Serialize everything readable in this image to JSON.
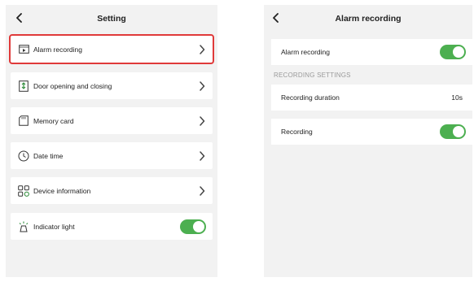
{
  "left_screen": {
    "title": "Setting",
    "items": [
      {
        "label": "Alarm recording",
        "icon": "video-file-icon"
      },
      {
        "label": "Door opening and closing",
        "icon": "door-icon"
      },
      {
        "label": "Memory card",
        "icon": "sd-card-icon"
      },
      {
        "label": "Date time",
        "icon": "clock-icon"
      },
      {
        "label": "Device information",
        "icon": "grid-icon"
      },
      {
        "label": "Indicator light",
        "icon": "light-icon",
        "toggle_on": true
      }
    ]
  },
  "right_screen": {
    "title": "Alarm recording",
    "alarm_recording_label": "Alarm recording",
    "alarm_recording_on": true,
    "section_label": "RECORDING SETTINGS",
    "duration_label": "Recording duration",
    "duration_value": "10s",
    "recording_label": "Recording",
    "recording_on": true
  },
  "colors": {
    "toggle_on": "#4caf50",
    "highlight": "#e03a3a"
  }
}
